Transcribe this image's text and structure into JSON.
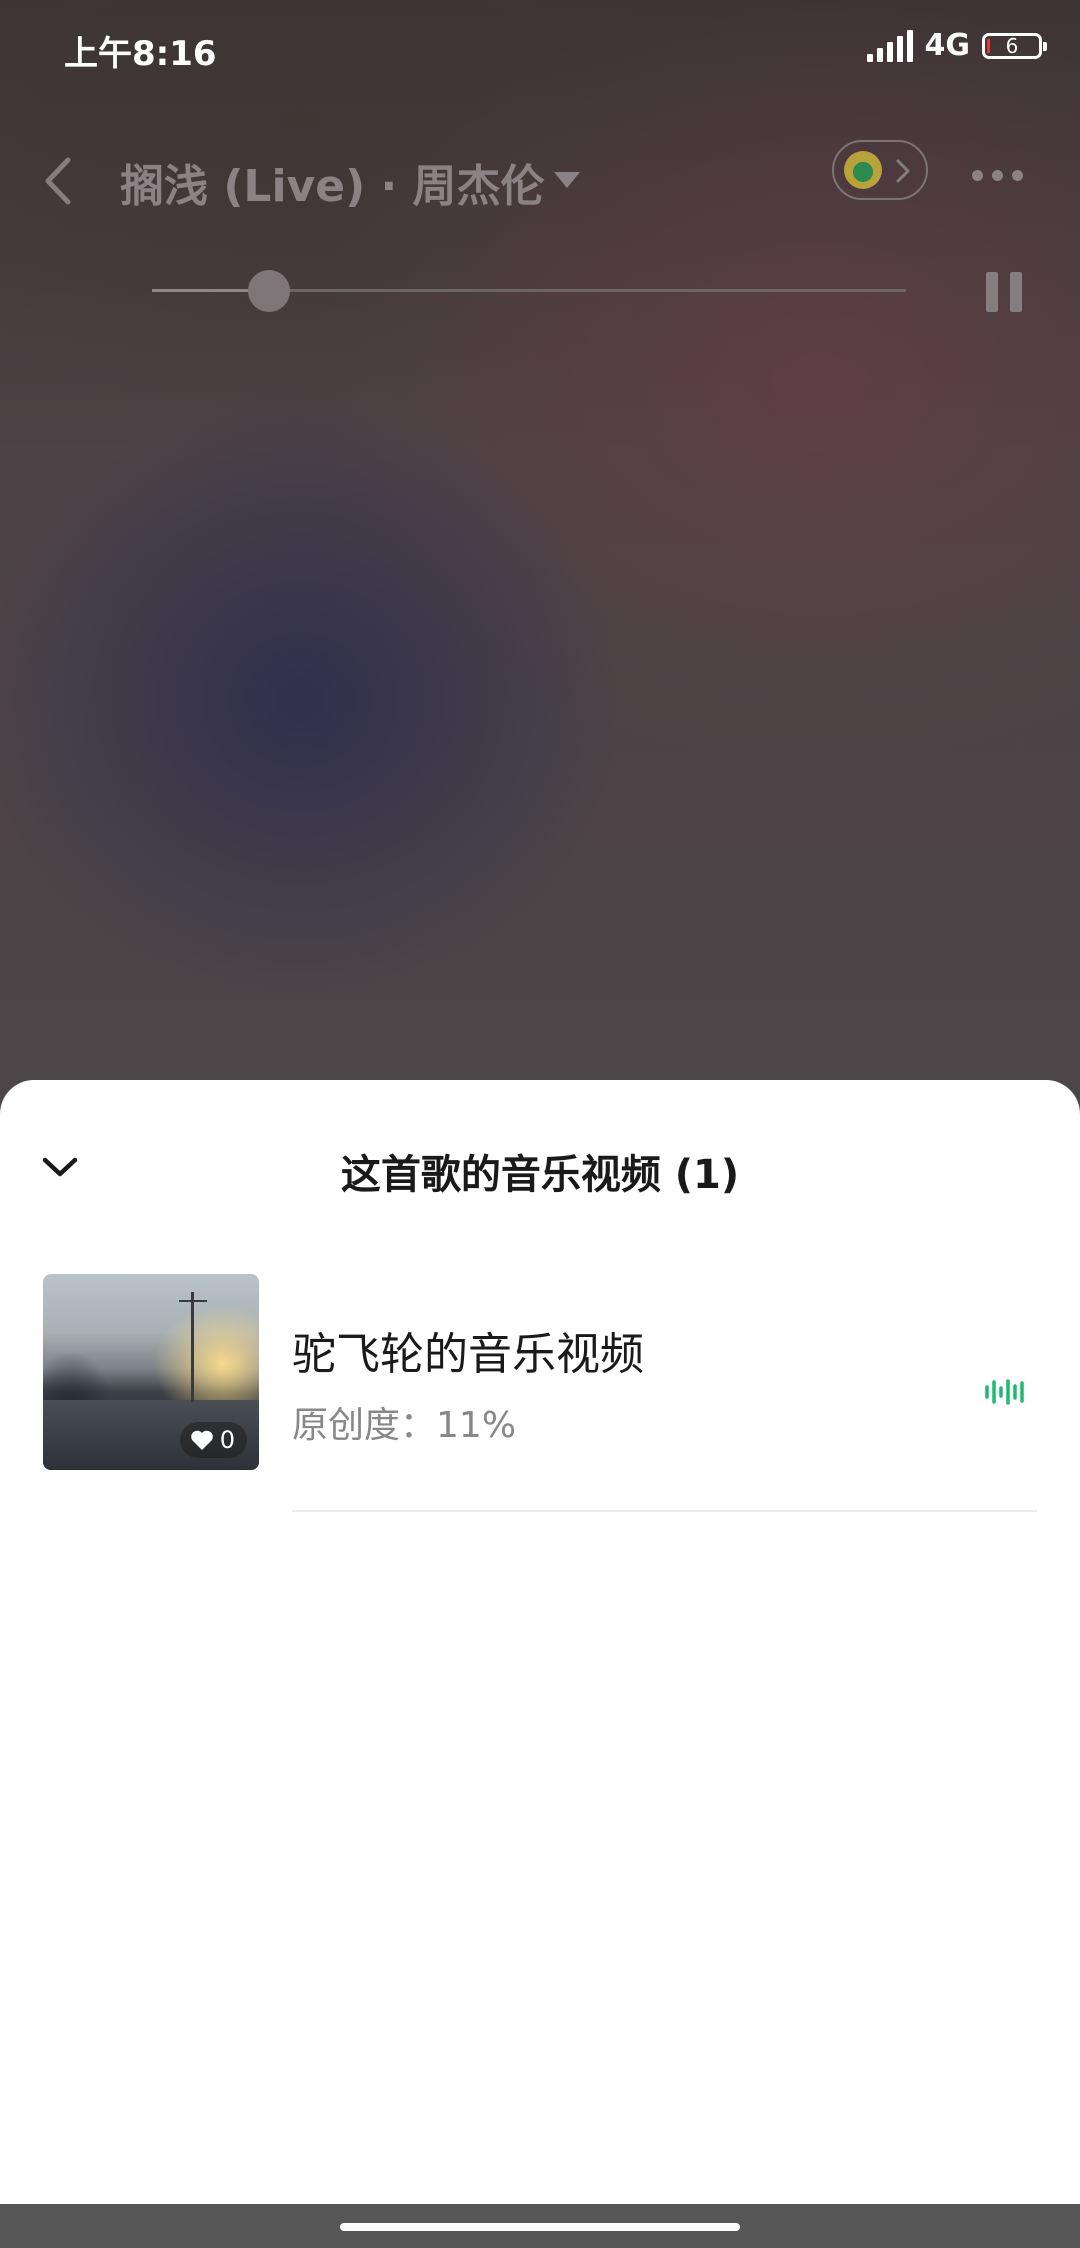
{
  "status_bar": {
    "time": "上午8:16",
    "network": "4G",
    "battery_level": "6"
  },
  "player": {
    "song_title": "搁浅 (Live) · 周杰伦",
    "progress_fraction": 0.155,
    "state": "playing"
  },
  "sheet": {
    "title": "这首歌的音乐视频 (1)",
    "videos": [
      {
        "title": "驼飞轮的音乐视频",
        "originality_label": "原创度：",
        "originality_value": "11%",
        "likes": "0",
        "now_playing": true
      }
    ]
  },
  "colors": {
    "accent_green": "#1fba6f",
    "sheet_background": "#ffffff",
    "nav_bar": "#575757"
  },
  "icons": {
    "back": "chevron-left-icon",
    "title_dropdown": "caret-down-icon",
    "qq_music": "qq-music-logo-icon",
    "more": "more-dots-icon",
    "pause": "pause-icon",
    "collapse": "chevron-down-icon",
    "like": "heart-icon",
    "now_playing": "sound-wave-icon"
  }
}
